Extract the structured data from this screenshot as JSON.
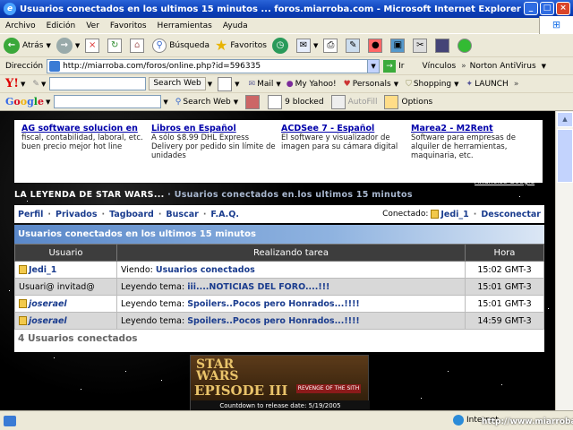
{
  "window": {
    "title": "Usuarios conectados en los ultimos 15 minutos ... foros.miarroba.com - Microsoft Internet Explorer"
  },
  "menu": [
    "Archivo",
    "Edición",
    "Ver",
    "Favoritos",
    "Herramientas",
    "Ayuda"
  ],
  "toolbar": {
    "back_label": "Atrás",
    "search_label": "Búsqueda",
    "favorites_label": "Favoritos"
  },
  "address": {
    "label": "Dirección",
    "url": "http://miarroba.com/foros/online.php?id=596335",
    "go_label": "Ir",
    "links_label": "Vínculos",
    "norton_label": "Norton AntiVirus"
  },
  "yahoo_bar": {
    "search_web": "Search Web",
    "mail": "Mail",
    "my_yahoo": "My Yahoo!",
    "personals": "Personals",
    "shopping": "Shopping",
    "launch": "LAUNCH"
  },
  "google_bar": {
    "search_web": "Search Web",
    "blocked": "9 blocked",
    "autofill": "AutoFill",
    "options": "Options"
  },
  "ads": [
    {
      "title": "AG software solucion en",
      "text": "fiscal, contabilidad, laboral, etc. buen precio mejor hot line"
    },
    {
      "title": "Libros en Español",
      "text": "A sólo $8.99 DHL Express Delivery por pedido sin límite de unidades"
    },
    {
      "title": "ACDSee 7 - Español",
      "text": "El software y visualizador de imagen para su cámara digital"
    },
    {
      "title": "Marea2 - M2Rent",
      "text": "Software para empresas de alquiler de herramientas, maquinaria, etc."
    }
  ],
  "ads_by": "Anuncios Google",
  "breadcrumb": {
    "forum": "LA LEYENDA DE STAR WARS...",
    "sep": "·",
    "current": "Usuarios conectados en los ultimos 15 minutos"
  },
  "nav": {
    "links": [
      "Perfil",
      "Privados",
      "Tagboard",
      "Buscar",
      "F.A.Q."
    ],
    "connected_label": "Conectado:",
    "user": "Jedi_1",
    "logout": "Desconectar"
  },
  "panel": {
    "title": "Usuarios conectados en los ultimos 15 minutos",
    "columns": [
      "Usuario",
      "Realizando tarea",
      "Hora"
    ],
    "rows": [
      {
        "user": "Jedi_1",
        "action": "Viendo:",
        "target": "Usuarios conectados",
        "time": "15:02 GMT-3"
      },
      {
        "user": "Usuari@ invitad@",
        "action": "Leyendo tema:",
        "target": "iii....NOTICIAS DEL FORO....!!!",
        "time": "15:01 GMT-3"
      },
      {
        "user": "joserael",
        "action": "Leyendo tema:",
        "target": "Spoilers..Pocos pero Honrados...!!!!",
        "time": "15:01 GMT-3"
      },
      {
        "user": "joserael",
        "action": "Leyendo tema:",
        "target": "Spoilers..Pocos pero Honrados...!!!!",
        "time": "14:59 GMT-3"
      }
    ],
    "count": "4 Usuarios conectados"
  },
  "banner": {
    "line1": "STAR",
    "line2": "WARS",
    "episode": "EPISODE III",
    "subtitle": "REVENGE OF THE SITH",
    "countdown": "Countdown to release date:  5/19/2005"
  },
  "status": {
    "zone": "Internet",
    "watermark": "http://www.miarroba.com"
  }
}
